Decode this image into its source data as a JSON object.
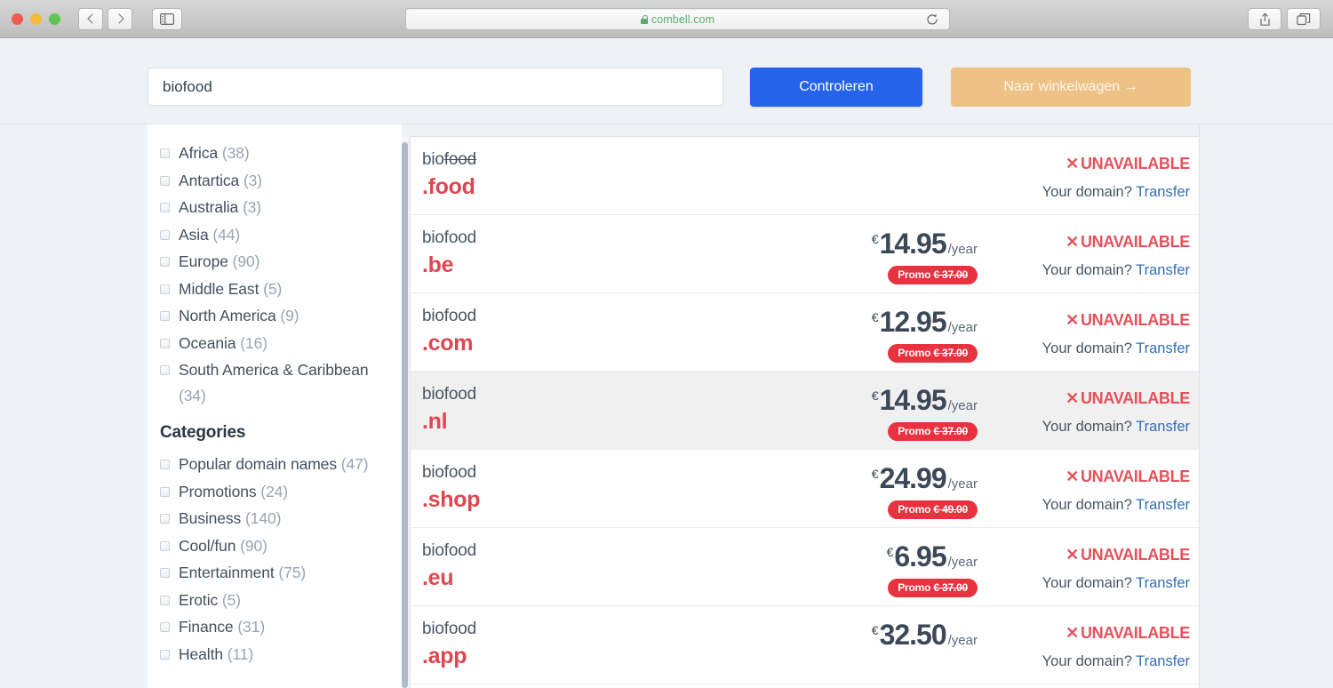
{
  "browser": {
    "url": "combell.com",
    "lock_icon": "lock-icon",
    "back_icon": "chevron-left-icon",
    "forward_icon": "chevron-right-icon",
    "sidebar_icon": "sidebar-toggle-icon",
    "reload_icon": "reload-icon",
    "share_icon": "share-icon",
    "tabs_icon": "tabs-icon"
  },
  "search": {
    "value": "biofood",
    "placeholder": "",
    "check_label": "Controleren",
    "cart_label": "Naar winkelwagen →"
  },
  "sidebar": {
    "regions": [
      {
        "label": "Africa",
        "count": "(38)"
      },
      {
        "label": "Antartica",
        "count": "(3)"
      },
      {
        "label": "Australia",
        "count": "(3)"
      },
      {
        "label": "Asia",
        "count": "(44)"
      },
      {
        "label": "Europe",
        "count": "(90)"
      },
      {
        "label": "Middle East",
        "count": "(5)"
      },
      {
        "label": "North America",
        "count": "(9)"
      },
      {
        "label": "Oceania",
        "count": "(16)"
      },
      {
        "label": "South America & Caribbean",
        "count": "(34)"
      }
    ],
    "categories_heading": "Categories",
    "categories": [
      {
        "label": "Popular domain names",
        "count": "(47)"
      },
      {
        "label": "Promotions",
        "count": "(24)"
      },
      {
        "label": "Business",
        "count": "(140)"
      },
      {
        "label": "Cool/fun",
        "count": "(90)"
      },
      {
        "label": "Entertainment",
        "count": "(75)"
      },
      {
        "label": "Erotic",
        "count": "(5)"
      },
      {
        "label": "Finance",
        "count": "(31)"
      },
      {
        "label": "Health",
        "count": "(11)"
      }
    ]
  },
  "results": {
    "status_label": "UNAVAILABLE",
    "status_mark": "✕",
    "transfer_prefix": "Your domain? ",
    "transfer_link": "Transfer",
    "currency": "€",
    "period": "/year",
    "promo_prefix": "Promo ",
    "rows": [
      {
        "name_plain": "bio",
        "name_struck": "food",
        "tld": ".food",
        "price": "",
        "promo": "",
        "highlighted": false
      },
      {
        "name_plain": "biofood",
        "name_struck": "",
        "tld": ".be",
        "price": "14.95",
        "promo": "€ 37.00",
        "highlighted": false
      },
      {
        "name_plain": "biofood",
        "name_struck": "",
        "tld": ".com",
        "price": "12.95",
        "promo": "€ 37.00",
        "highlighted": false
      },
      {
        "name_plain": "biofood",
        "name_struck": "",
        "tld": ".nl",
        "price": "14.95",
        "promo": "€ 37.00",
        "highlighted": true
      },
      {
        "name_plain": "biofood",
        "name_struck": "",
        "tld": ".shop",
        "price": "24.99",
        "promo": "€ 49.00",
        "highlighted": false
      },
      {
        "name_plain": "biofood",
        "name_struck": "",
        "tld": ".eu",
        "price": "6.95",
        "promo": "€ 37.00",
        "highlighted": false
      },
      {
        "name_plain": "biofood",
        "name_struck": "",
        "tld": ".app",
        "price": "32.50",
        "promo": "",
        "highlighted": false
      }
    ]
  },
  "colors": {
    "accent_blue": "#2563eb",
    "cart_tan": "#eec285",
    "brand_red": "#e04650",
    "promo_red": "#e8323f",
    "link_blue": "#2f6fbb",
    "page_bg": "#eef1f6"
  }
}
